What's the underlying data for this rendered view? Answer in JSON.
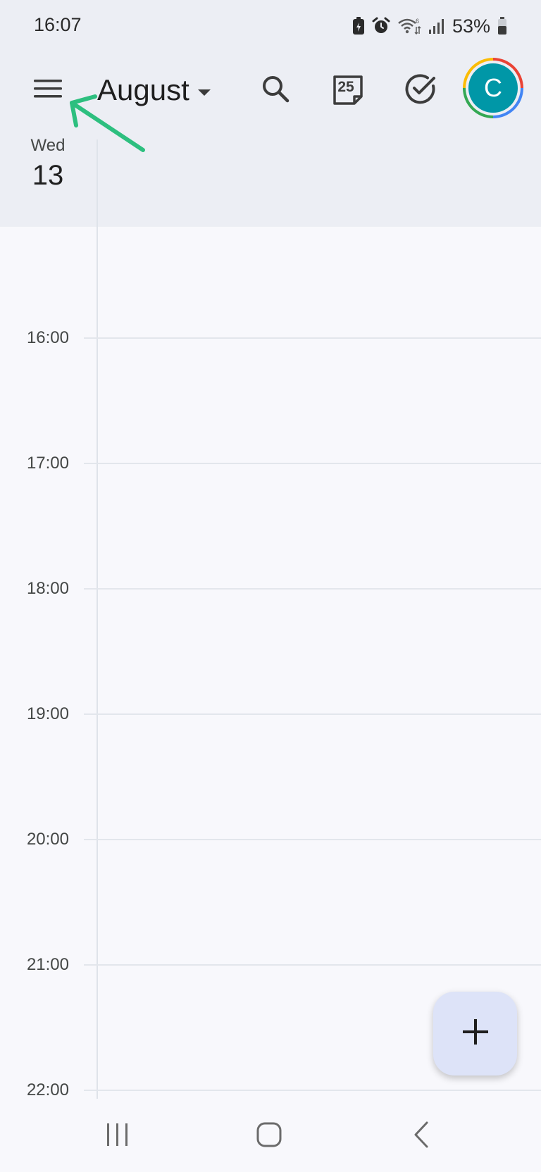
{
  "status_bar": {
    "time": "16:07",
    "battery_percent": "53%",
    "icons": [
      "battery-saver-icon",
      "alarm-icon",
      "wifi-6-icon",
      "signal-icon",
      "battery-icon"
    ]
  },
  "app_bar": {
    "menu_icon": "hamburger-menu-icon",
    "month": "August",
    "search_icon": "search-icon",
    "today_icon": "calendar-today-icon",
    "today_number": "25",
    "tasks_icon": "tasks-check-icon",
    "avatar_initial": "C",
    "avatar_color": "#0097a7"
  },
  "day_header": {
    "weekday": "Wed",
    "day": "13"
  },
  "timeline": {
    "hours": [
      "16:00",
      "17:00",
      "18:00",
      "19:00",
      "20:00",
      "21:00",
      "22:00"
    ]
  },
  "fab": {
    "icon": "plus-icon"
  },
  "nav_bar": {
    "recents_icon": "recents-icon",
    "home_icon": "home-icon",
    "back_icon": "back-icon"
  },
  "annotation": {
    "arrow_color": "#2dbf7f",
    "icon": "annotation-arrow-icon"
  }
}
